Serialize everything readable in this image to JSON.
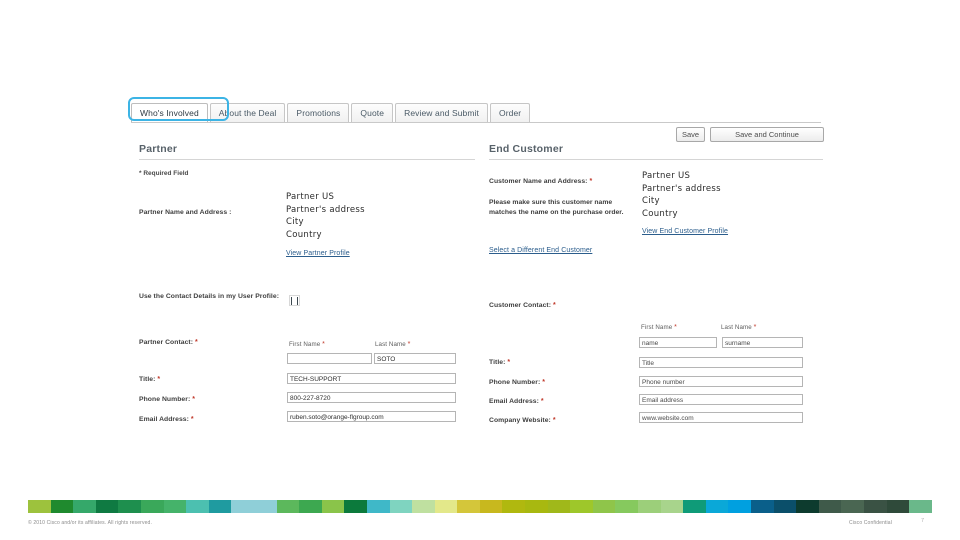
{
  "tabs": [
    {
      "label": "Who's Involved",
      "active": true
    },
    {
      "label": "About the Deal",
      "active": false
    },
    {
      "label": "Promotions",
      "active": false
    },
    {
      "label": "Quote",
      "active": false
    },
    {
      "label": "Review and Submit",
      "active": false
    },
    {
      "label": "Order",
      "active": false
    }
  ],
  "actions": {
    "save": "Save",
    "save_and_continue": "Save and Continue"
  },
  "partner": {
    "section_title": "Partner",
    "required_note": "* Required Field",
    "name_address_label": "Partner Name and Address :",
    "address_lines": "Partner US\nPartner's address\nCity\nCountry",
    "profile_link": "View Partner Profile",
    "use_contact_label": "Use the Contact Details in my User Profile:",
    "contact_label": "Partner Contact:",
    "first_name_caption": "First Name",
    "last_name_caption": "Last Name",
    "first_name_value": "",
    "last_name_value": "SOTO",
    "title_label": "Title:",
    "title_value": "TECH-SUPPORT",
    "phone_label": "Phone Number:",
    "phone_value": "800-227-8720",
    "email_label": "Email Address:",
    "email_value": "ruben.soto@orange-flgroup.com",
    "required_mark": "*"
  },
  "customer": {
    "section_title": "End Customer",
    "name_address_label": "Customer Name and Address:",
    "help_text": "Please make sure this customer name matches the name on the purchase order.",
    "select_different_link": "Select a Different End Customer",
    "address_lines": "Partner US\nPartner's address\nCity\nCountry",
    "profile_link": "View End Customer Profile",
    "contact_label": "Customer Contact:",
    "first_name_caption": "First Name",
    "last_name_caption": "Last Name",
    "first_name_placeholder": "name",
    "last_name_placeholder": "surname",
    "title_label": "Title:",
    "title_placeholder": "Title",
    "phone_label": "Phone Number:",
    "phone_placeholder": "Phone number",
    "email_label": "Email Address:",
    "email_placeholder": "Email address",
    "website_label": "Company Website:",
    "website_placeholder": "www.website.com",
    "required_mark": "*"
  },
  "footer": {
    "copyright": "© 2010 Cisco and/or its affiliates. All rights reserved.",
    "confidential": "Cisco Confidential",
    "page_number": "7"
  },
  "colors": {
    "accent": "#3cb4e5",
    "link": "#2b5d8c",
    "required": "#c0392b",
    "heading": "#58626a",
    "band": [
      "#9dc23d",
      "#1f8a2e",
      "#35a86a",
      "#0f7a42",
      "#1e8f4e",
      "#3aa85a",
      "#45b36a",
      "#4cc0b0",
      "#1f9ba0",
      "#8fcfd8",
      "#8fcfd8",
      "#5cb85c",
      "#3da850",
      "#8ac44a",
      "#0c7a3c",
      "#3fb8c8",
      "#7fd4c0",
      "#bfe0a0",
      "#e3e88a",
      "#d4c63a",
      "#c8b81e",
      "#b0b80f",
      "#a8b810",
      "#a0b81a",
      "#9ec72a",
      "#8fc54a",
      "#86c95e",
      "#9ccf7a",
      "#a8d48c",
      "#0f9b78",
      "#0aa8d8",
      "#00a0e0",
      "#0a5f8a",
      "#0b4f6a",
      "#0d3b2e",
      "#3f5a4a",
      "#4a6652",
      "#3a5244",
      "#2f4a3a",
      "#6ab88a"
    ]
  }
}
